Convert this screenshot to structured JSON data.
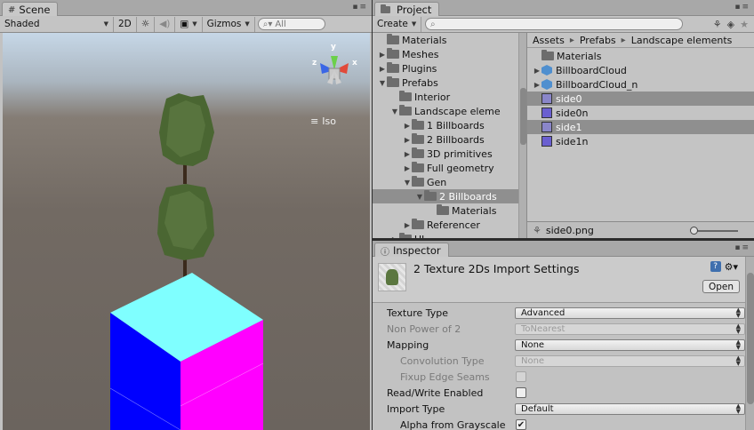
{
  "scene": {
    "tab": "Scene",
    "toolbar": {
      "shading_mode": "Shaded",
      "twod_label": "2D",
      "gizmos_label": "Gizmos",
      "search_placeholder": "All"
    },
    "view": {
      "iso_label": "Iso",
      "axes": {
        "x": "x",
        "y": "y",
        "z": "z"
      }
    }
  },
  "project": {
    "tab": "Project",
    "create_label": "Create",
    "tree": [
      {
        "label": "Materials",
        "depth": 1,
        "arrow": ""
      },
      {
        "label": "Meshes",
        "depth": 1,
        "arrow": "right"
      },
      {
        "label": "Plugins",
        "depth": 1,
        "arrow": "right"
      },
      {
        "label": "Prefabs",
        "depth": 1,
        "arrow": "down"
      },
      {
        "label": "Interior",
        "depth": 2,
        "arrow": ""
      },
      {
        "label": "Landscape eleme",
        "depth": 2,
        "arrow": "down"
      },
      {
        "label": "1 Billboards",
        "depth": 3,
        "arrow": "right"
      },
      {
        "label": "2 Billboards",
        "depth": 3,
        "arrow": "right"
      },
      {
        "label": "3D primitives",
        "depth": 3,
        "arrow": "right"
      },
      {
        "label": "Full geometry",
        "depth": 3,
        "arrow": "right"
      },
      {
        "label": "Gen",
        "depth": 3,
        "arrow": "down"
      },
      {
        "label": "2 Billboards",
        "depth": 4,
        "arrow": "down",
        "selected": true
      },
      {
        "label": "Materials",
        "depth": 5,
        "arrow": ""
      },
      {
        "label": "Referencer",
        "depth": 3,
        "arrow": "right"
      },
      {
        "label": "UI",
        "depth": 2,
        "arrow": "right"
      }
    ],
    "breadcrumb": [
      "Assets",
      "Prefabs",
      "Landscape elements"
    ],
    "files": [
      {
        "label": "Materials",
        "icon": "folder-icon",
        "arrow": ""
      },
      {
        "label": "BillboardCloud",
        "icon": "prefab-icon",
        "arrow": "right"
      },
      {
        "label": "BillboardCloud_n",
        "icon": "prefab-icon",
        "arrow": "right"
      },
      {
        "label": "side0",
        "icon": "texture-icon",
        "arrow": "",
        "selected": true
      },
      {
        "label": "side0n",
        "icon": "texture-icon",
        "arrow": ""
      },
      {
        "label": "side1",
        "icon": "texture-icon",
        "arrow": "",
        "selected": true
      },
      {
        "label": "side1n",
        "icon": "texture-icon",
        "arrow": ""
      }
    ],
    "status_file": "side0.png"
  },
  "inspector": {
    "tab": "Inspector",
    "title": "2 Texture 2Ds Import Settings",
    "open_label": "Open",
    "properties": [
      {
        "label": "Texture Type",
        "kind": "dropdown",
        "value": "Advanced",
        "indent": false,
        "dim": false
      },
      {
        "label": "Non Power of 2",
        "kind": "dropdown",
        "value": "ToNearest",
        "indent": false,
        "dim": true
      },
      {
        "label": "Mapping",
        "kind": "dropdown",
        "value": "None",
        "indent": false,
        "dim": false
      },
      {
        "label": "Convolution Type",
        "kind": "dropdown",
        "value": "None",
        "indent": true,
        "dim": true
      },
      {
        "label": "Fixup Edge Seams",
        "kind": "checkbox",
        "checked": false,
        "indent": true,
        "dim": true
      },
      {
        "label": "Read/Write Enabled",
        "kind": "checkbox",
        "checked": false,
        "indent": false,
        "dim": false
      },
      {
        "label": "Import Type",
        "kind": "dropdown",
        "value": "Default",
        "indent": false,
        "dim": false
      },
      {
        "label": "Alpha from Grayscale",
        "kind": "checkbox",
        "checked": true,
        "indent": true,
        "dim": false
      }
    ]
  },
  "colors": {
    "cube_top": "#7fffff",
    "cube_left": "#0000ff",
    "cube_right": "#ff00ff",
    "tree_green": "#4a6632",
    "selection": "#8f8f8f"
  }
}
